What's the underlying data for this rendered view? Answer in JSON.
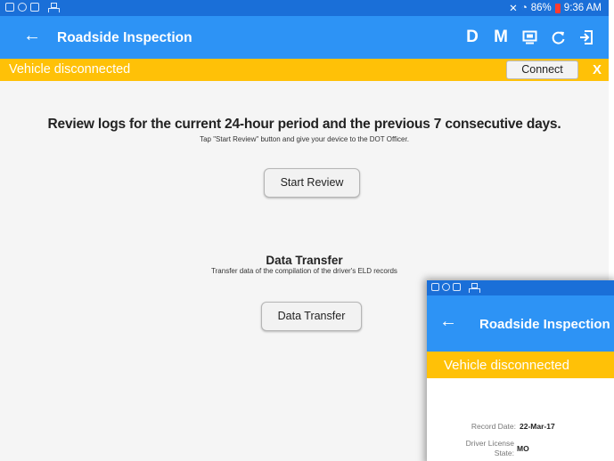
{
  "status_bar": {
    "battery": "86%",
    "time": "9:36 AM",
    "icons": [
      "notification-icon",
      "alarm-icon",
      "message-icon",
      "network-icon",
      "bluetooth-icon",
      "wifi-icon",
      "battery-icon"
    ]
  },
  "app_bar": {
    "back_icon": "back-arrow-icon",
    "title": "Roadside Inspection",
    "actions": [
      "D",
      "M"
    ],
    "action_icons": [
      "dashboard-icon",
      "refresh-icon",
      "logout-icon"
    ]
  },
  "banner": {
    "text": "Vehicle disconnected",
    "connect_label": "Connect",
    "close_label": "X"
  },
  "review": {
    "title": "Review logs for the current 24-hour period and the previous 7 consecutive days.",
    "subtitle": "Tap \"Start Review\" button and give your device to the DOT Officer.",
    "button_label": "Start Review"
  },
  "data_transfer": {
    "title": "Data Transfer",
    "subtitle": "Transfer data of the compilation of the driver's ELD records",
    "button_label": "Data Transfer"
  },
  "overlay": {
    "title": "Roadside Inspection",
    "banner_text": "Vehicle disconnected",
    "record_date_label": "Record Date:",
    "record_date_value": "22-Mar-17",
    "license_state_label_1": "Driver License",
    "license_state_label_2": "State:",
    "license_state_value": "MO"
  },
  "colors": {
    "status_bar": "#1a6fd8",
    "app_bar": "#2d93f5",
    "banner": "#ffc107",
    "battery_low": "#ff3b30"
  }
}
